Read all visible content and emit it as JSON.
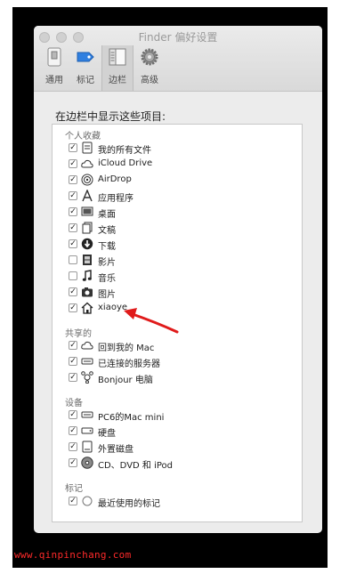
{
  "window": {
    "title": "Finder 偏好设置"
  },
  "toolbar": {
    "tabs": [
      {
        "label": "通用",
        "icon": "general-icon"
      },
      {
        "label": "标记",
        "icon": "tag-icon"
      },
      {
        "label": "边栏",
        "icon": "sidebar-icon",
        "active": true
      },
      {
        "label": "高级",
        "icon": "gear-icon"
      }
    ]
  },
  "sidebar_prefs": {
    "heading": "在边栏中显示这些项目:",
    "sections": [
      {
        "title": "个人收藏",
        "items": [
          {
            "label": "我的所有文件",
            "checked": true,
            "icon": "all-files-icon"
          },
          {
            "label": "iCloud Drive",
            "checked": true,
            "icon": "cloud-icon"
          },
          {
            "label": "AirDrop",
            "checked": true,
            "icon": "airdrop-icon"
          },
          {
            "label": "应用程序",
            "checked": true,
            "icon": "applications-icon"
          },
          {
            "label": "桌面",
            "checked": true,
            "icon": "desktop-icon"
          },
          {
            "label": "文稿",
            "checked": true,
            "icon": "documents-icon"
          },
          {
            "label": "下载",
            "checked": true,
            "icon": "download-icon"
          },
          {
            "label": "影片",
            "checked": false,
            "icon": "movies-icon"
          },
          {
            "label": "音乐",
            "checked": false,
            "icon": "music-icon"
          },
          {
            "label": "图片",
            "checked": true,
            "icon": "pictures-icon"
          },
          {
            "label": "xiaoye",
            "checked": true,
            "icon": "home-icon"
          }
        ]
      },
      {
        "title": "共享的",
        "items": [
          {
            "label": "回到我的 Mac",
            "checked": true,
            "icon": "cloud-icon"
          },
          {
            "label": "已连接的服务器",
            "checked": true,
            "icon": "server-icon"
          },
          {
            "label": "Bonjour 电脑",
            "checked": true,
            "icon": "bonjour-icon"
          }
        ]
      },
      {
        "title": "设备",
        "items": [
          {
            "label": "PC6的Mac mini",
            "checked": true,
            "icon": "mac-mini-icon"
          },
          {
            "label": "硬盘",
            "checked": true,
            "icon": "hard-disk-icon"
          },
          {
            "label": "外置磁盘",
            "checked": true,
            "icon": "external-disk-icon"
          },
          {
            "label": "CD、DVD 和 iPod",
            "checked": true,
            "icon": "optical-disc-icon"
          }
        ]
      },
      {
        "title": "标记",
        "items": [
          {
            "label": "最近使用的标记",
            "checked": true,
            "icon": "tag-circle-icon"
          }
        ]
      }
    ]
  },
  "watermark": "www.qinpinchang.com",
  "colors": {
    "annotation_arrow": "#e01b1b",
    "tag_blue": "#2f7fe0",
    "watermark": "#ff2a2a"
  }
}
